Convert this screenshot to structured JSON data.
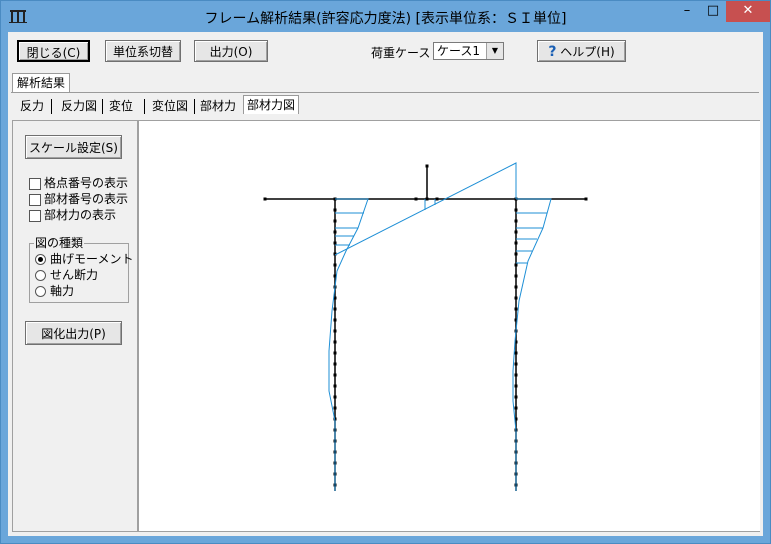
{
  "window": {
    "title": "フレーム解析結果(許容応力度法) [表示単位系：ＳＩ単位]",
    "app_icon": "frame-app-icon",
    "minimize_glyph": "–",
    "maximize_glyph": "□",
    "close_glyph": "✕"
  },
  "toolbar": {
    "close_label": "閉じる(C)",
    "unit_switch_label": "単位系切替",
    "output_label": "出力(O)",
    "load_case_label": "荷重ケース",
    "load_case_value": "ケース1",
    "help_label": "ヘルプ(H)",
    "help_icon": "question-icon"
  },
  "tabs": {
    "outer_label": "解析結果",
    "items": [
      {
        "label": "反力"
      },
      {
        "label": "反力図"
      },
      {
        "label": "変位"
      },
      {
        "label": "変位図"
      },
      {
        "label": "部材力"
      },
      {
        "label": "部材力図"
      }
    ],
    "active": "部材力図"
  },
  "sidebar": {
    "scale_button": "スケール設定(S)",
    "checkboxes": [
      {
        "label": "格点番号の表示",
        "checked": false
      },
      {
        "label": "部材番号の表示",
        "checked": false
      },
      {
        "label": "部材力の表示",
        "checked": false
      }
    ],
    "diagram_type_title": "図の種類",
    "diagram_types": [
      {
        "label": "曲げモーメント",
        "selected": true
      },
      {
        "label": "せん断力",
        "selected": false
      },
      {
        "label": "軸力",
        "selected": false
      }
    ],
    "plot_output_button": "図化出力(P)"
  },
  "colors": {
    "titlebar": "#6aa6da",
    "frame_member": "#000000",
    "diagram_line": "#1e8fd6",
    "close_button": "#c75050"
  }
}
